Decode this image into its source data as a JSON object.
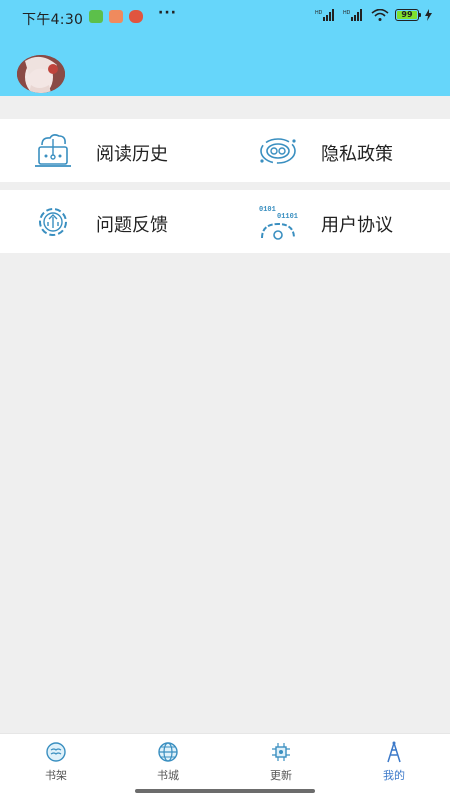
{
  "status_bar": {
    "time": "下午4:30",
    "more": "···",
    "battery_level": "99",
    "battery_fraction": 0.99
  },
  "profile": {
    "avatar": "avatar-image"
  },
  "menu": [
    {
      "label": "阅读历史",
      "icon": "reading-history-icon"
    },
    {
      "label": "隐私政策",
      "icon": "privacy-policy-icon"
    },
    {
      "label": "问题反馈",
      "icon": "feedback-icon"
    },
    {
      "label": "用户协议",
      "icon": "user-agreement-icon"
    }
  ],
  "tabbar": {
    "tabs": [
      {
        "label": "书架",
        "icon": "bookshelf-icon"
      },
      {
        "label": "书城",
        "icon": "bookstore-icon"
      },
      {
        "label": "更新",
        "icon": "updates-icon"
      },
      {
        "label": "我的",
        "icon": "profile-icon"
      }
    ],
    "active_index": 3
  },
  "colors": {
    "header": "#66d6fa",
    "accent": "#3c79c9",
    "icon_blue": "#3a8fc0",
    "background": "#efefef"
  }
}
